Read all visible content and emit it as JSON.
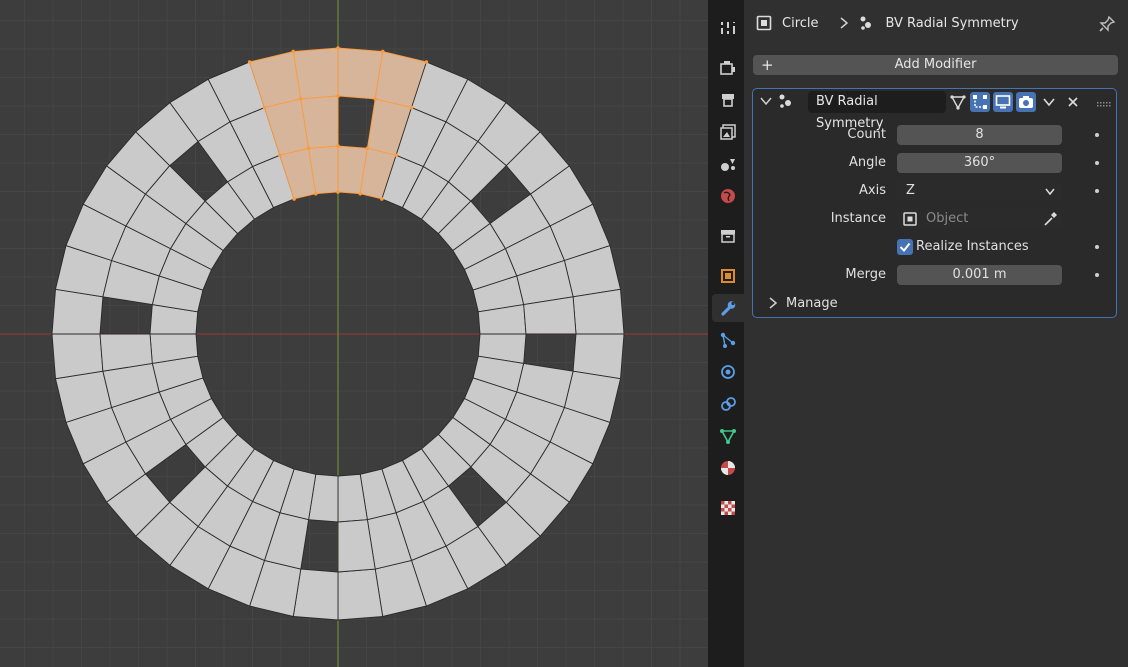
{
  "breadcrumb": {
    "object_name": "Circle",
    "modifier_name": "BV Radial Symmetry"
  },
  "add_modifier_label": "Add Modifier",
  "modifier": {
    "name": "BV Radial Symmetry",
    "fields": {
      "count": {
        "label": "Count",
        "value": "8"
      },
      "angle": {
        "label": "Angle",
        "value": "360°"
      },
      "axis": {
        "label": "Axis",
        "value": "Z"
      },
      "instance": {
        "label": "Instance",
        "placeholder": "Object"
      },
      "realize": {
        "label": "Realize Instances",
        "checked": true
      },
      "merge": {
        "label": "Merge",
        "value": "0.001 m"
      }
    },
    "manage_label": "Manage"
  },
  "colors": {
    "accent": "#4772b3",
    "selection": "#ff9a3c",
    "mesh_face": "#c9cac9"
  }
}
